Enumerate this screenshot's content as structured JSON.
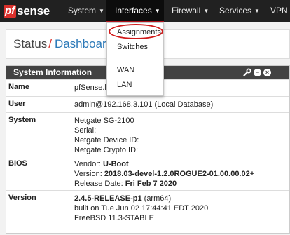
{
  "navbar": {
    "logo_pf": "pf",
    "logo_sense": "sense",
    "items": [
      {
        "label": "System"
      },
      {
        "label": "Interfaces"
      },
      {
        "label": "Firewall"
      },
      {
        "label": "Services"
      },
      {
        "label": "VPN"
      }
    ],
    "active": "Interfaces"
  },
  "dropdown": {
    "items": [
      "Assignments",
      "Switches",
      "WAN",
      "LAN"
    ],
    "highlighted": "Assignments"
  },
  "breadcrumb": {
    "section": "Status",
    "separator": "/",
    "page": "Dashboard"
  },
  "panel": {
    "title": "System Information",
    "rows": [
      {
        "label": "Name",
        "lines": [
          "pfSense.lo"
        ]
      },
      {
        "label": "User",
        "lines": [
          "admin@192.168.3.101 (Local Database)"
        ]
      },
      {
        "label": "System",
        "lines": [
          "Netgate SG-2100",
          "Serial:",
          "Netgate Device ID:",
          "Netgate Crypto ID:"
        ]
      },
      {
        "label": "BIOS",
        "lines": [
          "Vendor: U-Boot",
          "Version: 2018.03-devel-1.2.0ROGUE2-01.00.00.02+",
          "Release Date: Fri Feb 7 2020"
        ],
        "bold_parts": [
          "U-Boot",
          "2018.03-devel-1.2.0ROGUE2-01.00.00.02+",
          "Fri Feb 7 2020"
        ]
      },
      {
        "label": "Version",
        "lines": [
          "2.4.5-RELEASE-p1 (arm64)",
          "built on Tue Jun 02 17:44:41 EDT 2020",
          "FreeBSD 11.3-STABLE"
        ],
        "bold_parts": [
          "2.4.5-RELEASE-p1"
        ]
      }
    ]
  },
  "colors": {
    "navbar_bg": "#212121",
    "brand_red": "#d9302b",
    "link_blue": "#2b79b8",
    "panel_head": "#424242",
    "highlight": "#d11919"
  },
  "icons": [
    "wrench-icon",
    "minus-circle-icon",
    "close-circle-icon",
    "caret-down-icon"
  ]
}
